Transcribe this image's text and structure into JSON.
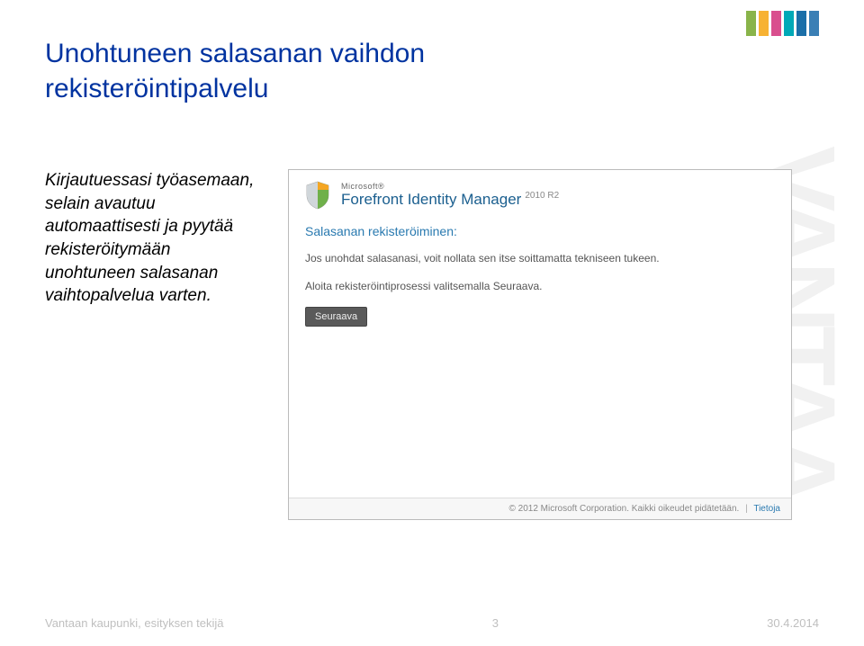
{
  "title_line1": "Unohtuneen salasanan vaihdon",
  "title_line2": "rekisteröintipalvelu",
  "body_text": "Kirjautuessasi työasemaan, selain avautuu automaattisesti ja pyytää rekisteröitymään unohtuneen salasanan vaihtopalvelua varten.",
  "dialog": {
    "ms_label": "Microsoft®",
    "product": "Forefront Identity Manager",
    "version": "2010 R2",
    "reg_title": "Salasanan rekisteröiminen:",
    "p1": "Jos unohdat salasanasi, voit nollata sen itse soittamatta tekniseen tukeen.",
    "p2": "Aloita rekisteröintiprosessi valitsemalla Seuraava.",
    "next_label": "Seuraava",
    "copyright": "© 2012 Microsoft Corporation. Kaikki oikeudet pidätetään.",
    "about_link": "Tietoja"
  },
  "strip_colors": [
    "#89b44a",
    "#f7b233",
    "#d94f8e",
    "#00a9b7",
    "#1b6fa8",
    "#3a7fb5"
  ],
  "watermark": "VANTAA",
  "footer": {
    "left": "Vantaan kaupunki, esityksen tekijä",
    "page": "3",
    "date": "30.4.2014"
  }
}
